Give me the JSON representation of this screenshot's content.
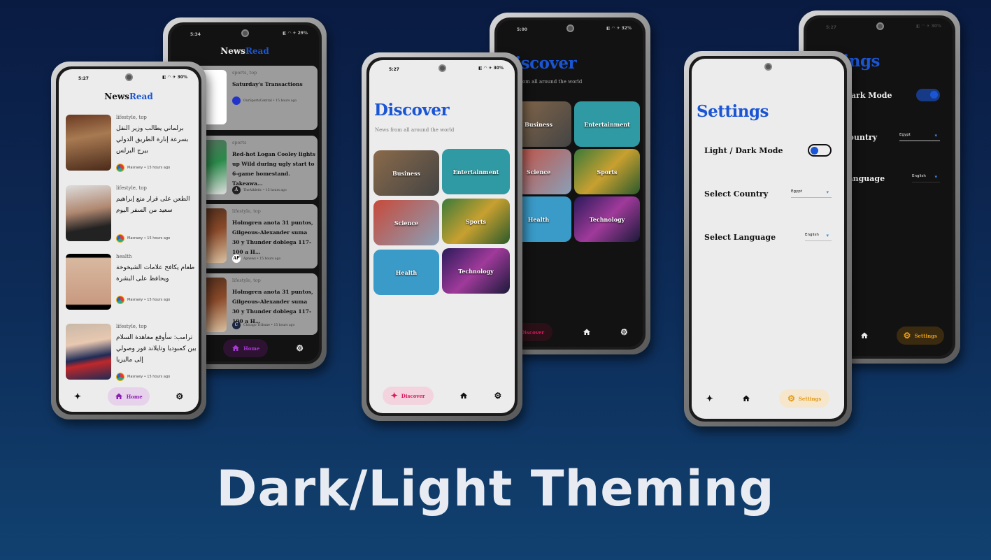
{
  "headline": "Dark/Light Theming",
  "colors": {
    "accent_blue": "#1a55d4",
    "home_purple": "#8a1fb0",
    "discover_pink": "#d81b60",
    "settings_orange": "#e39a16"
  },
  "app": {
    "logo_part1": "News",
    "logo_part2": "Read"
  },
  "status": {
    "light_home": {
      "time": "5:27",
      "battery": "30%"
    },
    "dark_home": {
      "time": "5:34",
      "battery": "29%"
    },
    "light_discover": {
      "time": "5:27",
      "battery": "30%"
    },
    "dark_discover": {
      "time": "5:00",
      "battery": "32%"
    },
    "light_settings": {
      "time": "5:27",
      "battery": "30%"
    },
    "dark_settings": {
      "time": "5:27",
      "battery": "30%"
    }
  },
  "nav": {
    "discover": "Discover",
    "home": "Home",
    "settings": "Settings",
    "sparkle_icon": "✦",
    "gear_icon": "⚙"
  },
  "home_light": {
    "articles": [
      {
        "category": "lifestyle, top",
        "title": "برلماني يطالب وزير النقل بسرعة إنارة الطريق الدولي بيرج البرلس",
        "source": "Masrawy • 15 hours ago"
      },
      {
        "category": "lifestyle, top",
        "title": "الطعن على قرار منع إبراهيم سعيد من السفر اليوم",
        "source": "Masrawy • 15 hours ago"
      },
      {
        "category": "health",
        "title": "طعام يكافح علامات الشيخوخة ويحافظ على البشرة",
        "source": "Masrawy • 15 hours ago"
      },
      {
        "category": "lifestyle, top",
        "title": "ترامب: سأوقع معاهدة السلام بين كمبوديا وتايلاند فور وصولي إلى ماليزيا",
        "source": "Masrawy • 15 hours ago"
      }
    ]
  },
  "home_dark": {
    "articles": [
      {
        "category": "sports, top",
        "title": "Saturday's Transactions",
        "source": "OurSportsCentral • 15 hours ago"
      },
      {
        "category": "sports",
        "title": "Red-hot Logan Cooley lights up Wild during ugly start to 6-game homestand. Takeawa...",
        "source": "TheAthletic • 15 hours ago"
      },
      {
        "category": "lifestyle, top",
        "title": "Holmgren anota 31 puntos, Gilgeous-Alexander suma 30 y Thunder doblega 117-100 a H...",
        "source": "Apnews • 15 hours ago",
        "badge": "AP"
      },
      {
        "category": "lifestyle, top",
        "title": "Holmgren anota 31 puntos, Gilgeous-Alexander suma 30 y Thunder doblega 117-100 a H...",
        "source": "Chicago Tribune • 15 hours ago",
        "badge": "C"
      }
    ]
  },
  "discover": {
    "title": "Discover",
    "subtitle": "News from all around the world",
    "categories": [
      "Business",
      "Entertainment",
      "Science",
      "Sports",
      "Health",
      "Technology"
    ]
  },
  "settings": {
    "title": "Settings",
    "mode_label": "Light / Dark Mode",
    "country_label": "Select Country",
    "country_value": "Egypt",
    "language_label": "Select Language",
    "language_value": "English",
    "light_dark_mode_on": false,
    "dark_dark_mode_on": true
  }
}
